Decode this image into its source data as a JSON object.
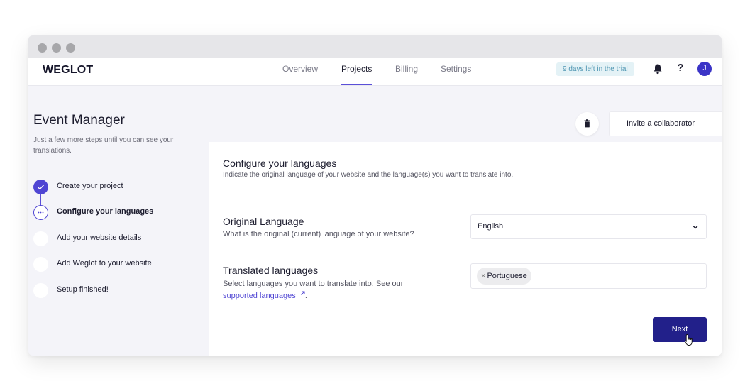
{
  "app": {
    "logo": "WEGLOT",
    "nav": [
      "Overview",
      "Projects",
      "Billing",
      "Settings"
    ],
    "active_nav": "Projects",
    "trial_badge": "9 days left in the trial",
    "help_label": "?",
    "avatar_initial": "J"
  },
  "sidebar": {
    "title": "Event Manager",
    "subtitle": "Just a few more steps until you can see your translations.",
    "steps": [
      {
        "label": "Create your project",
        "status": "done"
      },
      {
        "label": "Configure your languages",
        "status": "current"
      },
      {
        "label": "Add your website details",
        "status": "pending"
      },
      {
        "label": "Add Weglot to your website",
        "status": "pending"
      },
      {
        "label": "Setup finished!",
        "status": "pending"
      }
    ]
  },
  "toolbar": {
    "delete_icon": "trash-icon",
    "invite_label": "Invite a collaborator"
  },
  "card": {
    "title": "Configure your languages",
    "subtitle": "Indicate the original language of your website and the language(s) you want to translate into.",
    "original": {
      "title": "Original Language",
      "description": "What is the original (current) language of your website?",
      "selected": "English"
    },
    "translated": {
      "title": "Translated languages",
      "description": "Select languages you want to translate into. See our",
      "link_text": "supported languages",
      "after_link": ".",
      "tag_remove": "×",
      "tags": [
        "Portuguese"
      ]
    },
    "next_label": "Next"
  },
  "colors": {
    "accent": "#4f45d3",
    "primary_button": "#22208a",
    "trial_bg": "#e4f2f6",
    "trial_text": "#4f96b2"
  }
}
